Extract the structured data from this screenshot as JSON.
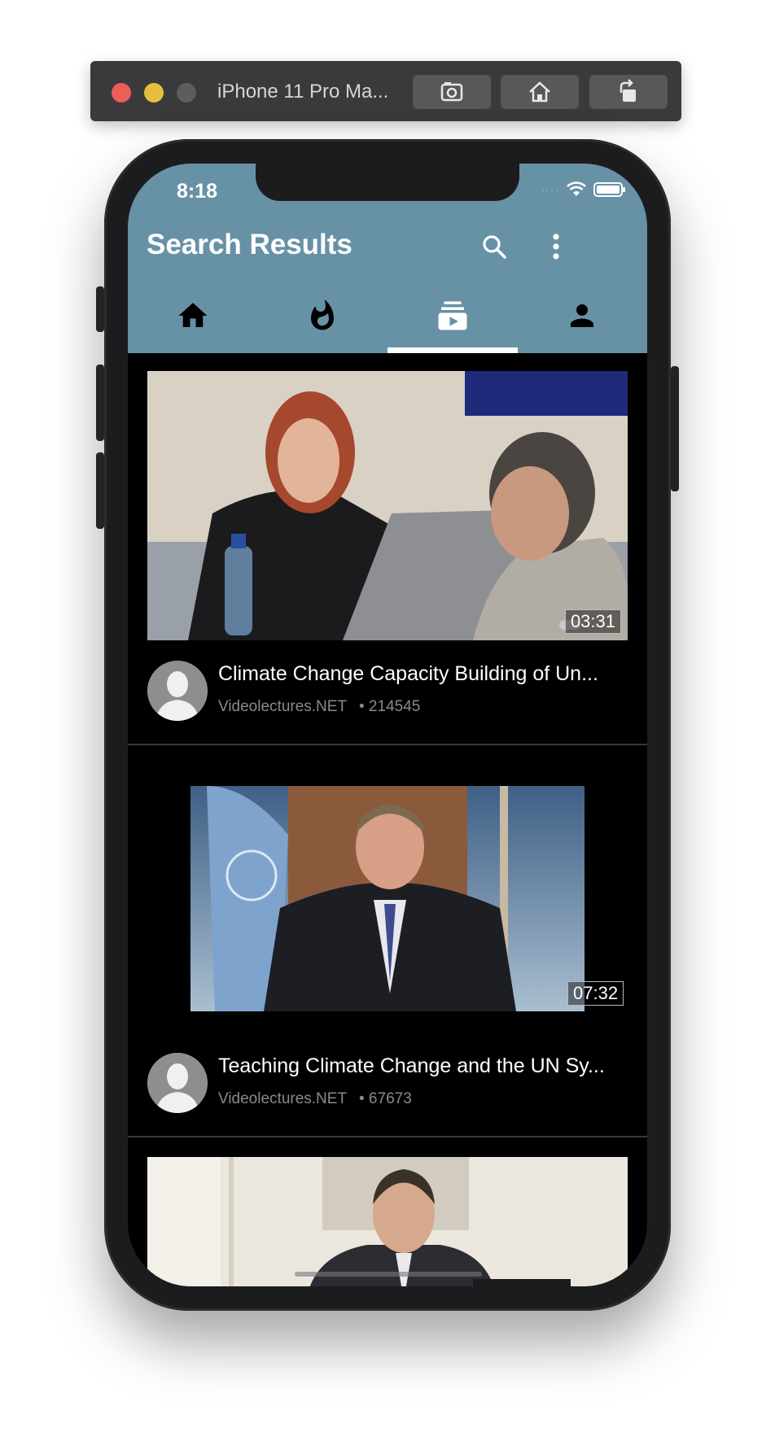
{
  "simulator": {
    "title": "iPhone 11 Pro Ma...",
    "buttons": [
      "screenshot-icon",
      "home-icon",
      "rotate-icon"
    ]
  },
  "status_bar": {
    "time": "8:18",
    "signal": "····"
  },
  "app_bar": {
    "title": "Search Results",
    "icons": [
      "search-icon",
      "more-vert-icon"
    ]
  },
  "tabs": [
    {
      "name": "home",
      "icon": "home-icon",
      "active": false
    },
    {
      "name": "trending",
      "icon": "fire-icon",
      "active": false
    },
    {
      "name": "subscriptions",
      "icon": "subscriptions-icon",
      "active": true
    },
    {
      "name": "account",
      "icon": "person-icon",
      "active": false
    }
  ],
  "videos": [
    {
      "title": "Climate Change  Capacity Building of Un...",
      "channel": "Videolectures.NET",
      "views": "• 214545",
      "duration": "03:31"
    },
    {
      "title": "Teaching Climate Change and the UN Sy...",
      "channel": "Videolectures.NET",
      "views": "• 67673",
      "duration": "07:32"
    },
    {
      "title": "",
      "channel": "",
      "views": "",
      "duration": ""
    }
  ],
  "colors": {
    "header": "#6792a6",
    "background": "#000000",
    "accent": "#ffffff"
  }
}
